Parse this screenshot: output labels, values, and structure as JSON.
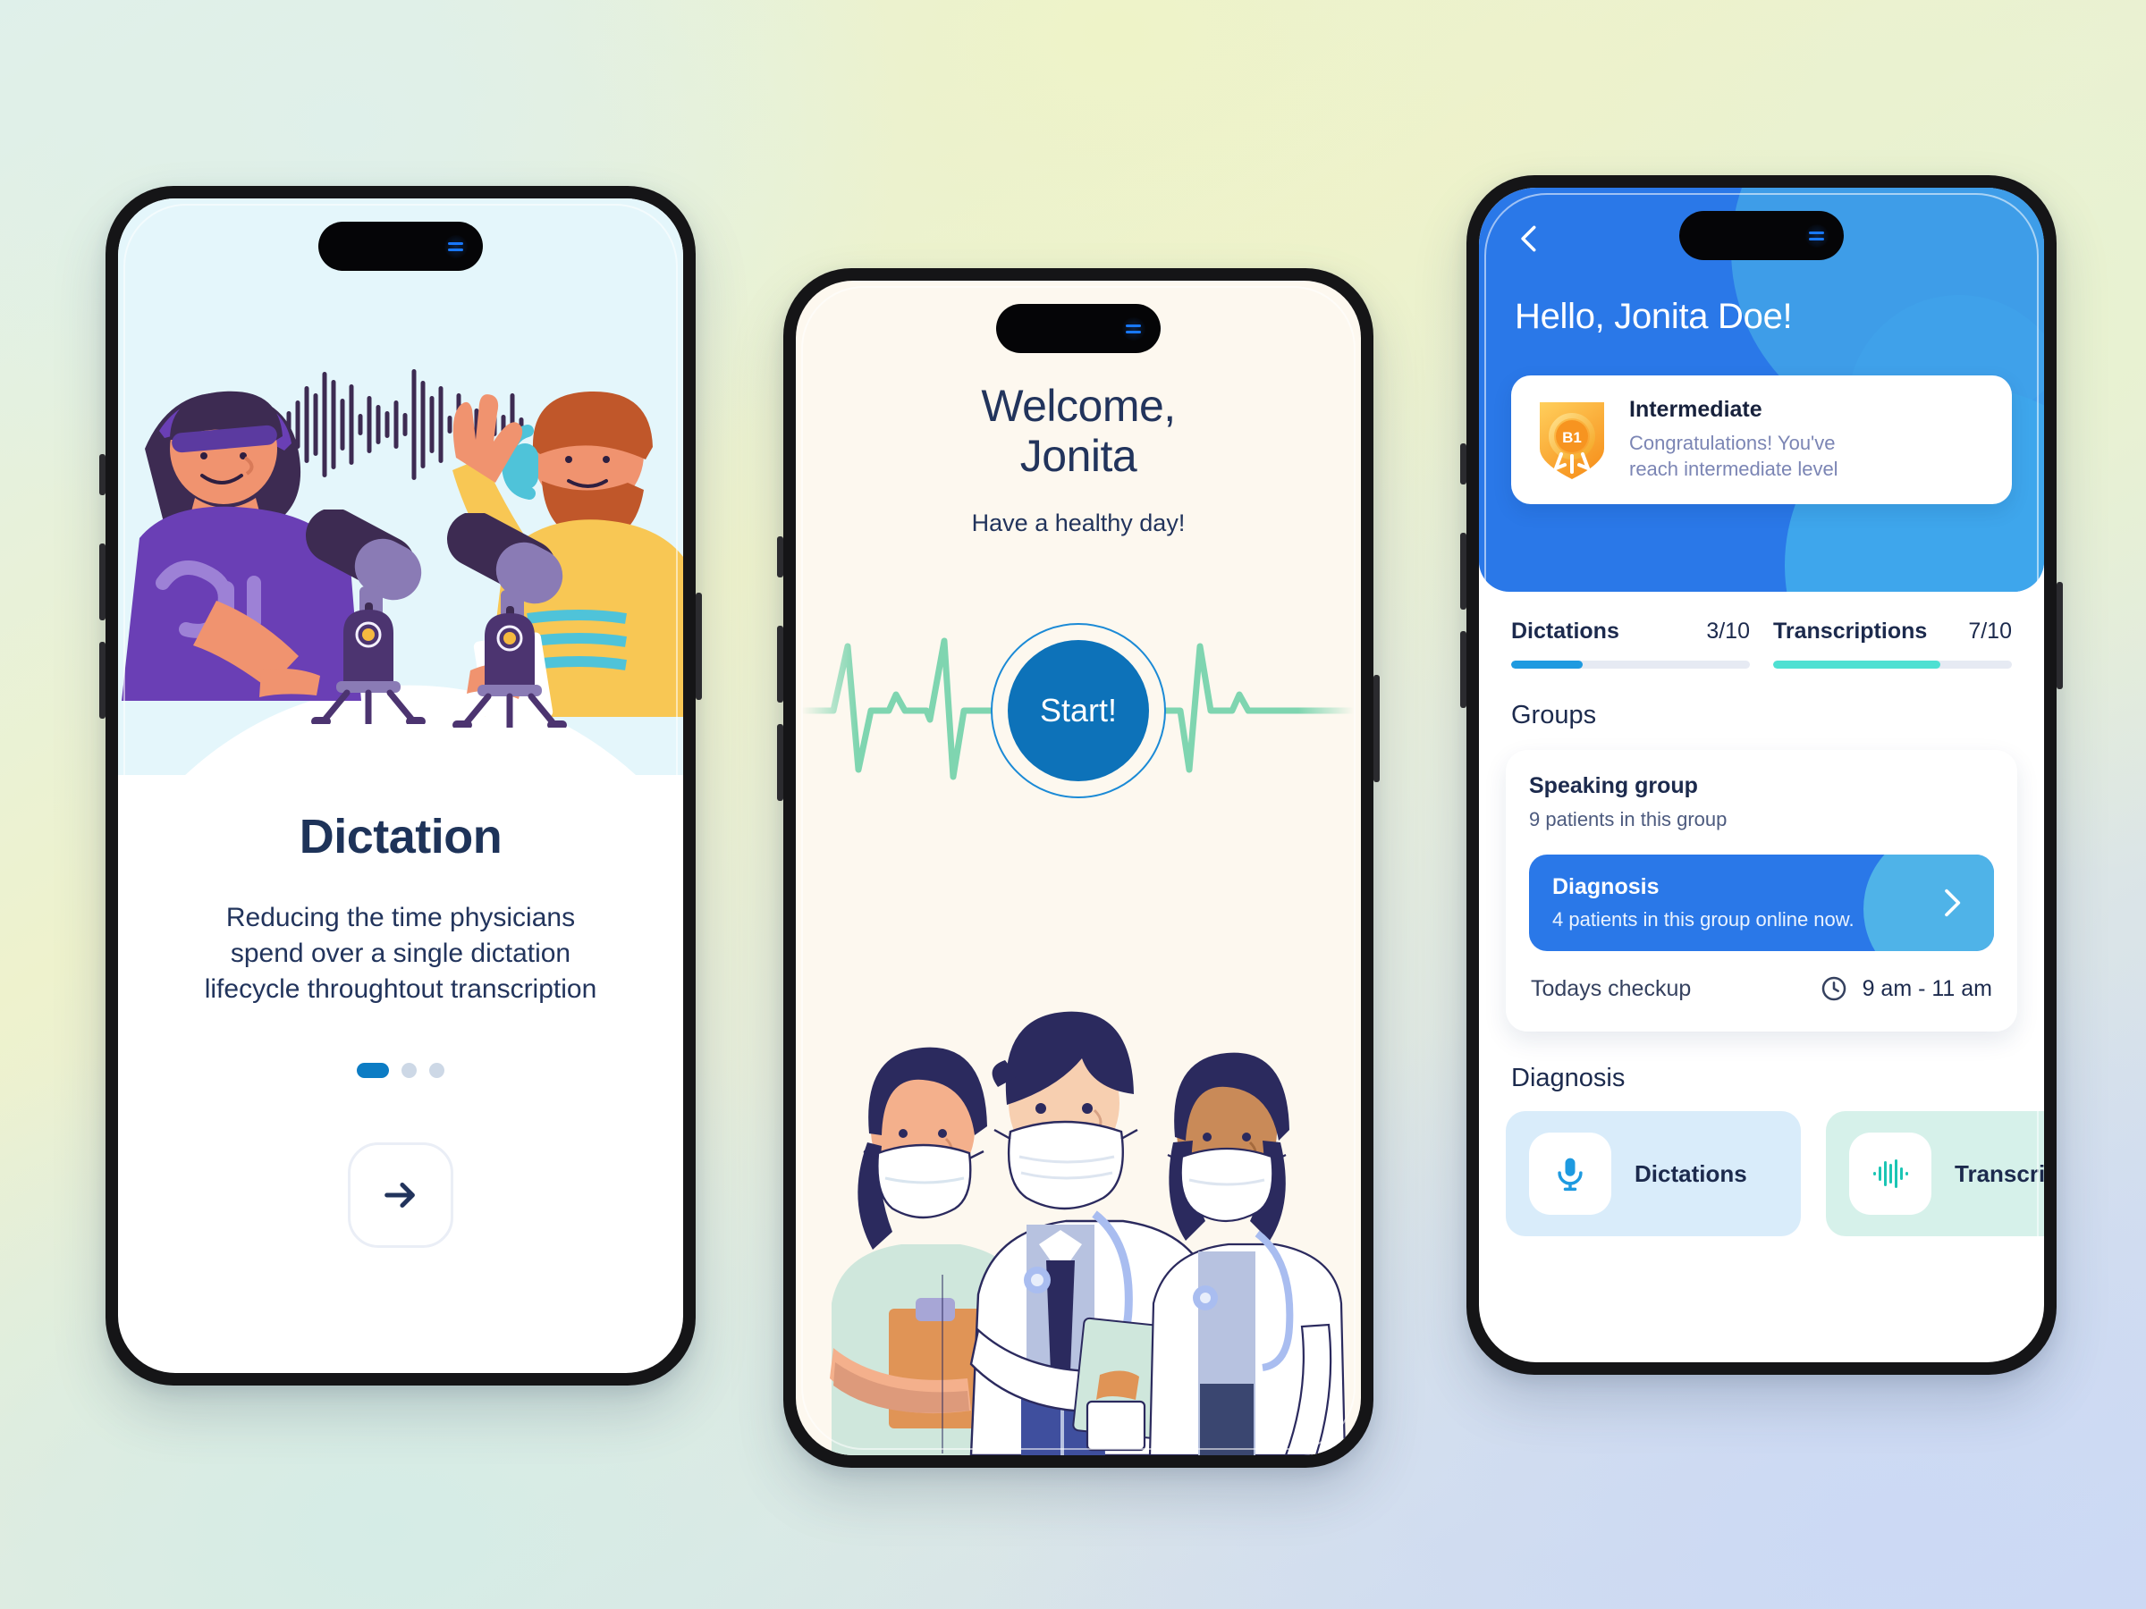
{
  "phone1": {
    "screen_name": "Dictation onboarding",
    "title": "Dictation",
    "description": "Reducing the time physicians spend over a single dictation lifecycle throughtout transcription",
    "description_lines": [
      "Reducing the time physicians",
      "spend over a single dictation",
      "lifecycle throughtout transcription"
    ],
    "pagination": {
      "total": 3,
      "active_index": 0
    },
    "next_icon": "arrow-right-icon",
    "illustration": "two-podcasters-with-microphones-illustration",
    "waveform_icon": "audio-waveform-icon",
    "colors": {
      "art_bg": "#e4f6fb",
      "title": "#1e3359",
      "accent": "#0c7cc4"
    }
  },
  "phone2": {
    "screen_name": "Welcome",
    "title_line1": "Welcome,",
    "title_line2": "Jonita",
    "subtitle": "Have a healthy day!",
    "start_label": "Start!",
    "ekg_icon": "heartbeat-line-icon",
    "illustration": "three-masked-doctors-illustration",
    "colors": {
      "bg": "#fdf8ef",
      "start_fill": "#0d72b9",
      "ekg": "#7fd5b0"
    }
  },
  "phone3": {
    "screen_name": "Home dashboard",
    "back_icon": "chevron-left-icon",
    "greeting": "Hello, Jonita Doe!",
    "badge": {
      "icon": "shield-award-badge-icon",
      "level_code": "B1",
      "title": "Intermediate",
      "message": "Congratulations! You've reach intermediate level",
      "message_lines": [
        "Congratulations! You've",
        "reach intermediate level"
      ]
    },
    "stats": [
      {
        "label": "Dictations",
        "value": "3/10",
        "percent": 30,
        "color": "#1e9ae0"
      },
      {
        "label": "Transcriptions",
        "value": "7/10",
        "percent": 70,
        "color": "#4ee0d2"
      }
    ],
    "groups_section_title": "Groups",
    "group": {
      "name": "Speaking group",
      "meta": "9 patients in this group"
    },
    "diagnosis_card": {
      "name": "Diagnosis",
      "meta": "4 patients in this group online now.",
      "chevron_icon": "chevron-right-icon"
    },
    "checkup": {
      "label": "Todays checkup",
      "clock_icon": "clock-icon",
      "time": "9 am - 11 am"
    },
    "diagnosis_section_title": "Diagnosis",
    "tiles": [
      {
        "label": "Dictations",
        "icon": "microphone-icon",
        "bg": "#d9ecfa",
        "icon_color": "#1e9ae0"
      },
      {
        "label": "Transcriptions",
        "icon": "audio-waveform-icon",
        "bg": "#d6f1ea",
        "icon_color": "#1bc5b4"
      }
    ],
    "colors": {
      "hero": "#2a78e8",
      "hero_light": "#3ea6ec",
      "text": "#1c2a4d"
    }
  }
}
